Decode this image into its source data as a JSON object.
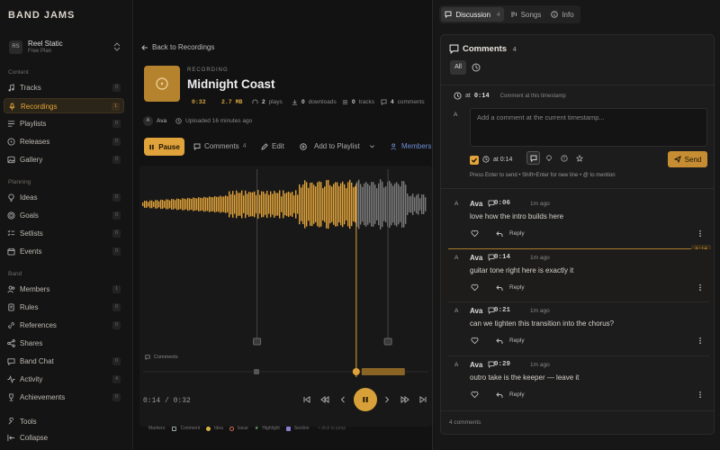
{
  "app": {
    "brand": "BAND JAMS"
  },
  "workspace": {
    "initials": "RS",
    "name": "Reel Static",
    "plan": "Free Plan"
  },
  "sidebar": {
    "sections": [
      {
        "label": "Content",
        "items": [
          {
            "label": "Tracks",
            "count": "0",
            "icon": "music-note-icon"
          },
          {
            "label": "Recordings",
            "count": "1",
            "icon": "microphone-icon",
            "active": true
          },
          {
            "label": "Playlists",
            "count": "0",
            "icon": "list-icon"
          },
          {
            "label": "Releases",
            "count": "0",
            "icon": "disc-icon"
          },
          {
            "label": "Gallery",
            "count": "0",
            "icon": "image-icon"
          }
        ]
      },
      {
        "label": "Planning",
        "items": [
          {
            "label": "Ideas",
            "count": "0",
            "icon": "lightbulb-icon"
          },
          {
            "label": "Goals",
            "count": "0",
            "icon": "target-icon"
          },
          {
            "label": "Setlists",
            "count": "0",
            "icon": "checklist-icon"
          },
          {
            "label": "Events",
            "count": "0",
            "icon": "calendar-icon"
          }
        ]
      },
      {
        "label": "Band",
        "items": [
          {
            "label": "Members",
            "count": "1",
            "icon": "users-icon"
          },
          {
            "label": "Rules",
            "count": "0",
            "icon": "scroll-icon"
          },
          {
            "label": "References",
            "count": "0",
            "icon": "link-icon"
          },
          {
            "label": "Shares",
            "count": "",
            "icon": "share-icon"
          },
          {
            "label": "Band Chat",
            "count": "0",
            "icon": "chat-icon"
          },
          {
            "label": "Activity",
            "count": "4",
            "icon": "activity-icon"
          },
          {
            "label": "Achievements",
            "count": "0",
            "icon": "trophy-icon"
          }
        ]
      }
    ],
    "bottom": [
      {
        "label": "Tools",
        "icon": "wrench-icon"
      },
      {
        "label": "Collapse",
        "icon": "collapse-icon"
      }
    ]
  },
  "main": {
    "back_label": "Back to Recordings",
    "type_label": "RECORDING",
    "title": "Midnight Coast",
    "duration": "0:32",
    "size": "2.7 MB",
    "plays": "2",
    "plays_label": "plays",
    "downloads": "0",
    "downloads_label": "downloads",
    "tracks": "0",
    "tracks_label": "tracks",
    "comments": "4",
    "comments_label": "comments",
    "uploader_initial": "A",
    "uploader": "Ava",
    "uploaded": "Uploaded 16 minutes ago",
    "toolbar": {
      "pause": "Pause",
      "comments": "Comments",
      "comments_count": "4",
      "edit": "Edit",
      "add_playlist": "Add to Playlist",
      "members": "Members"
    },
    "lane_label": "Comments",
    "progress": 0.4375,
    "time": "0:14 / 0:32",
    "markers_label": "Markers:",
    "markers": [
      "Comment",
      "Idea",
      "Issue",
      "Highlight",
      "Section"
    ],
    "markers_hint": "click to jump"
  },
  "panel": {
    "tabs": [
      {
        "label": "Discussion",
        "count": "4",
        "active": true
      },
      {
        "label": "Songs"
      },
      {
        "label": "Info"
      }
    ],
    "title": "Comments",
    "count": "4",
    "filter_all": "All",
    "composer": {
      "at_label": "at",
      "timestamp": "0:14",
      "hint": "Comment at this timestamp",
      "placeholder": "Add a comment at the current timestamp...",
      "checkbox_time": "at 0:14",
      "send": "Send",
      "help": "Press Enter to send • Shift+Enter for new line • @ to mention"
    },
    "playhead_time": "0:14",
    "reply_label": "Reply",
    "comments": [
      {
        "initial": "A",
        "author": "Ava",
        "time": "0:06",
        "ago": "1m ago",
        "text": "love how the intro builds here"
      },
      {
        "initial": "A",
        "author": "Ava",
        "time": "0:14",
        "ago": "1m ago",
        "text": "guitar tone right here is exactly it"
      },
      {
        "initial": "A",
        "author": "Ava",
        "time": "0:21",
        "ago": "1m ago",
        "text": "can we tighten this transition into the chorus?"
      },
      {
        "initial": "A",
        "author": "Ava",
        "time": "0:29",
        "ago": "1m ago",
        "text": "outro take is the keeper — leave it"
      }
    ],
    "footer": "4 comments"
  },
  "colors": {
    "accent": "#e0a23a",
    "background": "#121212",
    "panel": "#1c1c1c"
  }
}
